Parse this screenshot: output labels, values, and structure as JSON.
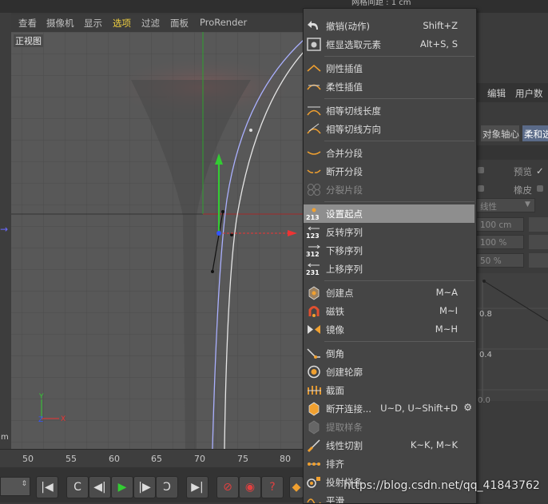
{
  "top_status": "网格间距 : 1 cm",
  "viewport_menu": [
    "查看",
    "摄像机",
    "显示",
    "选项",
    "过滤",
    "面板",
    "ProRender"
  ],
  "viewport_menu_active": "选项",
  "viewport_label": "正视图",
  "left_edge_label": "m",
  "ruler_ticks": [
    "50",
    "55",
    "60",
    "65",
    "70",
    "75",
    "80"
  ],
  "transport_buttons": [
    "go-start-icon",
    "prev-key-icon",
    "prev-frame-icon",
    "play-icon",
    "next-frame-icon",
    "next-key-icon",
    "go-end-icon",
    "record-icon",
    "autokey-icon",
    "help-icon"
  ],
  "context_menu": {
    "items": [
      {
        "label": "撤销(动作)",
        "shortcut": "Shift+Z",
        "icon": "undo-icon"
      },
      {
        "label": "框显选取元素",
        "shortcut": "Alt+S, S",
        "icon": "frame-selected-icon"
      },
      {
        "label": "刚性插值",
        "shortcut": "",
        "icon": "hard-interpolation-icon"
      },
      {
        "label": "柔性插值",
        "shortcut": "",
        "icon": "soft-interpolation-icon"
      },
      {
        "label": "相等切线长度",
        "shortcut": "",
        "icon": "equal-tangent-length-icon"
      },
      {
        "label": "相等切线方向",
        "shortcut": "",
        "icon": "equal-tangent-direction-icon"
      },
      {
        "label": "合并分段",
        "shortcut": "",
        "icon": "join-segment-icon"
      },
      {
        "label": "断开分段",
        "shortcut": "",
        "icon": "break-segment-icon"
      },
      {
        "label": "分裂片段",
        "shortcut": "",
        "icon": "explode-segments-icon",
        "disabled": true
      },
      {
        "label": "设置起点",
        "shortcut": "",
        "icon": "set-first-point-icon",
        "highlighted": true
      },
      {
        "label": "反转序列",
        "shortcut": "",
        "icon": "reverse-sequence-icon"
      },
      {
        "label": "下移序列",
        "shortcut": "",
        "icon": "move-down-sequence-icon"
      },
      {
        "label": "上移序列",
        "shortcut": "",
        "icon": "move-up-sequence-icon"
      },
      {
        "label": "创建点",
        "shortcut": "M~A",
        "icon": "create-point-icon"
      },
      {
        "label": "磁铁",
        "shortcut": "M~I",
        "icon": "magnet-icon"
      },
      {
        "label": "镜像",
        "shortcut": "M~H",
        "icon": "mirror-icon"
      },
      {
        "label": "倒角",
        "shortcut": "",
        "icon": "chamfer-icon"
      },
      {
        "label": "创建轮廓",
        "shortcut": "",
        "icon": "create-outline-icon"
      },
      {
        "label": "截面",
        "shortcut": "",
        "icon": "cross-section-icon"
      },
      {
        "label": "断开连接...",
        "shortcut": "U~D, U~Shift+D",
        "icon": "disconnect-icon",
        "has_gear": true
      },
      {
        "label": "提取样条",
        "shortcut": "",
        "icon": "extract-spline-icon",
        "disabled": true
      },
      {
        "label": "线性切割",
        "shortcut": "K~K, M~K",
        "icon": "line-cut-icon"
      },
      {
        "label": "排齐",
        "shortcut": "",
        "icon": "arrange-icon"
      },
      {
        "label": "投射样条",
        "shortcut": "",
        "icon": "project-spline-icon"
      },
      {
        "label": "平滑",
        "shortcut": "",
        "icon": "smooth-icon"
      }
    ]
  },
  "right_panel": {
    "tabs": [
      "编辑",
      "用户数"
    ],
    "subtabs": [
      "对象轴心",
      "柔和选"
    ],
    "preview_label": "预览",
    "rubber_label": "橡皮",
    "mode_select": "线性",
    "fields": [
      "100 cm",
      "100 %",
      "50 %"
    ],
    "graph_labels": [
      "0.8",
      "0.4",
      "0.0"
    ]
  },
  "watermark": "https://blog.csdn.net/qq_41843762",
  "colors": {
    "menu_active": "#f0d040",
    "highlight": "#8e8e8e",
    "spline": "#aab0ff",
    "axis_y": "#33cc33",
    "axis_x": "#ee3333"
  }
}
